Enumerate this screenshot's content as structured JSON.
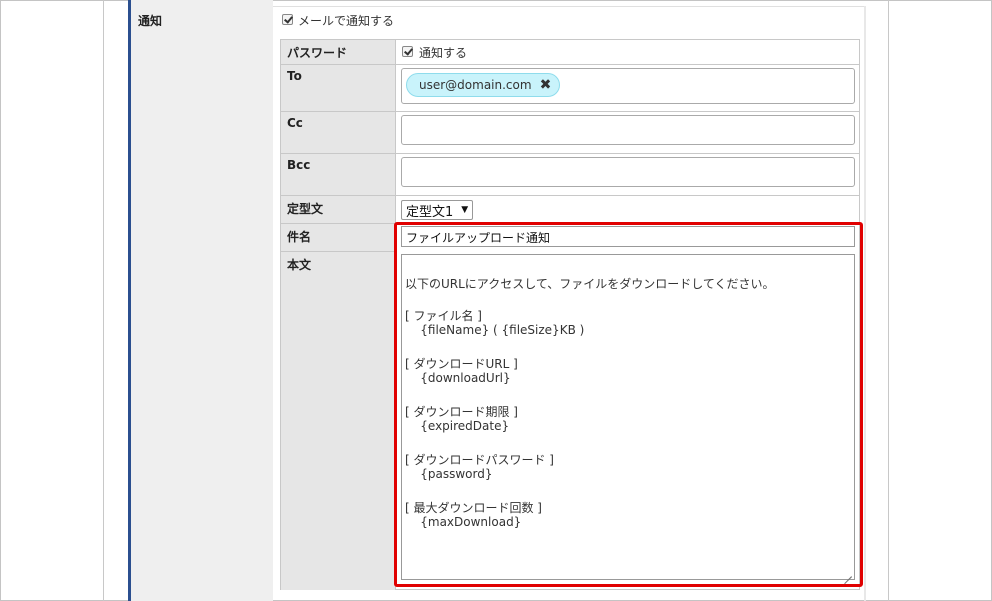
{
  "notify": {
    "label": "通知",
    "mail_notify_checked": true,
    "mail_notify_label": "メールで通知する"
  },
  "fields": {
    "password": {
      "label": "パスワード",
      "checked": true,
      "option_label": "通知する"
    },
    "to": {
      "label": "To",
      "chips": [
        "user@domain.com"
      ]
    },
    "cc": {
      "label": "Cc",
      "value": ""
    },
    "bcc": {
      "label": "Bcc",
      "value": ""
    },
    "template": {
      "label": "定型文",
      "selected": "定型文1"
    },
    "subject": {
      "label": "件名",
      "value": "ファイルアップロード通知"
    },
    "body": {
      "label": "本文",
      "lines": [
        "",
        "以下のURLにアクセスして、ファイルをダウンロードしてください。",
        "",
        "[ ファイル名 ]",
        "    {fileName} ( {fileSize}KB )",
        "",
        "[ ダウンロードURL ]",
        "    {downloadUrl}",
        "",
        "[ ダウンロード期限 ]",
        "    {expiredDate}",
        "",
        "[ ダウンロードパスワード ]",
        "    {password}",
        "",
        "[ 最大ダウンロード回数 ]",
        "    {maxDownload}"
      ]
    }
  },
  "colors": {
    "highlight": "#e00000",
    "chip_bg": "#c9f3fb",
    "label_bar": "#2b4f8f"
  }
}
